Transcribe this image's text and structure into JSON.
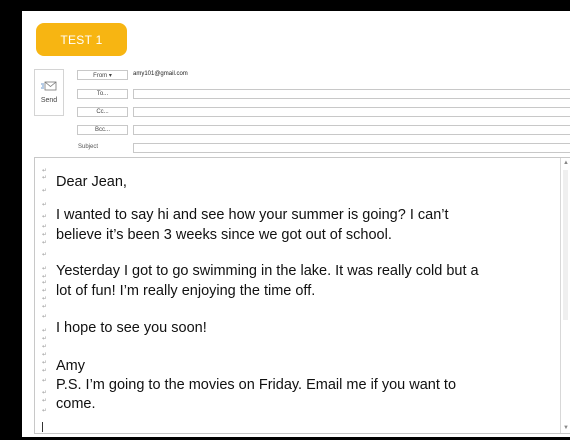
{
  "tag": {
    "label": "TEST 1"
  },
  "toolbar": {
    "send_label": "Send"
  },
  "header": {
    "from_button": "From ▾",
    "from_value": "amy101@gmail.com",
    "to_button": "To...",
    "cc_button": "Cc...",
    "bcc_button": "Bcc...",
    "subject_label": "Subject",
    "to_value": "",
    "cc_value": "",
    "bcc_value": "",
    "subject_value": ""
  },
  "body": {
    "lines": [
      "Dear Jean,",
      "I wanted to say hi and see how your summer is going? I can’t",
      "believe it’s been 3 weeks since we got out of school.",
      "Yesterday I got to go swimming in the lake. It was really cold but a",
      "lot of fun! I’m really enjoying the time off.",
      "I hope to see you soon!",
      "Amy",
      "P.S. I’m going to the movies on Friday. Email me if you want to",
      "come."
    ]
  },
  "colors": {
    "accent": "#f7b512",
    "background": "#000000"
  },
  "icons": {
    "send": "send-envelope-icon"
  }
}
